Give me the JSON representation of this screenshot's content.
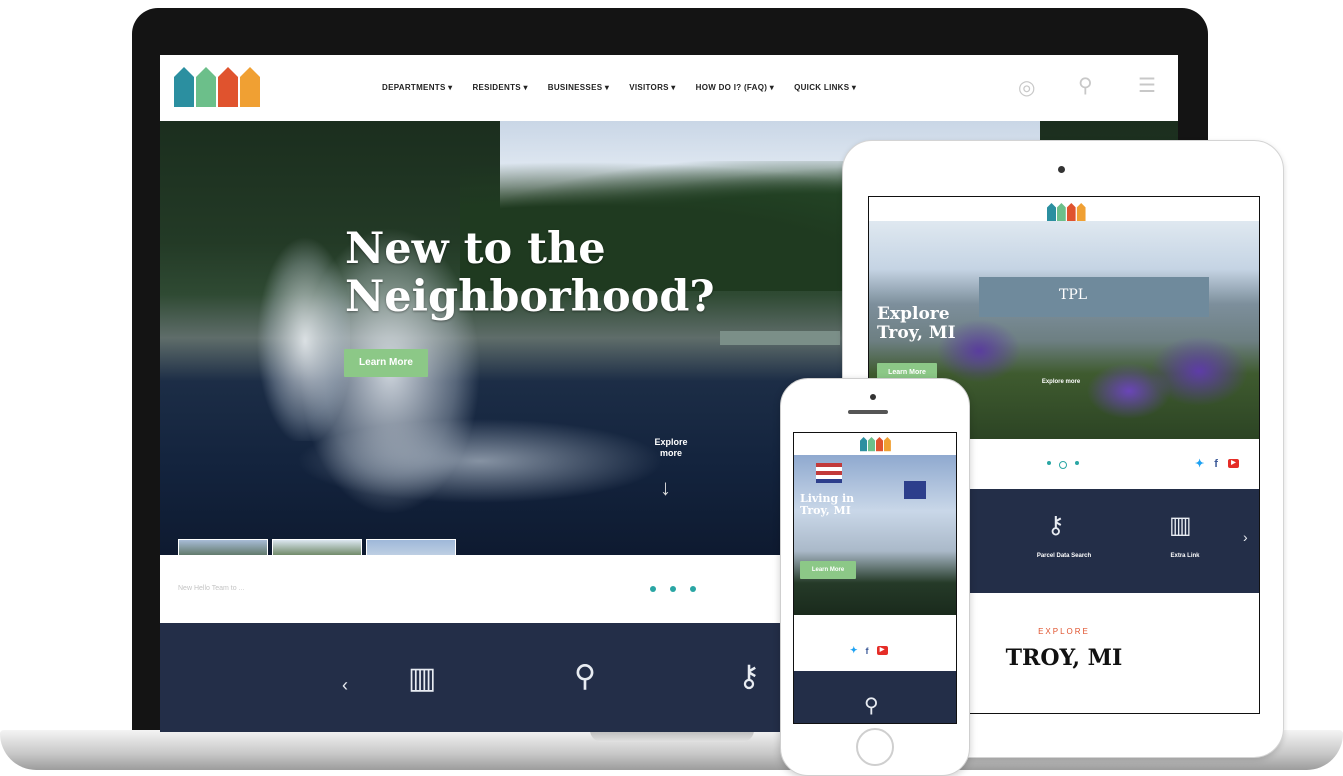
{
  "laptop": {
    "nav": [
      "DEPARTMENTS ▾",
      "RESIDENTS ▾",
      "BUSINESSES ▾",
      "VISITORS ▾",
      "HOW DO I? (FAQ) ▾",
      "QUICK LINKS ▾"
    ],
    "hero_title": "New to the Neighborhood?",
    "hero_button": "Learn More",
    "explore": "Explore more",
    "explore_arrow": "↓",
    "bar_text": "New Hello Team to ..."
  },
  "tablet": {
    "hero_title": "Explore Troy, MI",
    "hero_button": "Learn More",
    "sign_text": "TPL",
    "explore": "Explore more",
    "dark_items": [
      "Parcel Data Search",
      "Extra Link"
    ],
    "kicker": "EXPLORE",
    "heading": "TROY, MI"
  },
  "phone": {
    "hero_title": "Living in Troy, MI",
    "hero_button": "Learn More"
  },
  "social": {
    "twitter": "twitter-icon",
    "facebook": "facebook-icon",
    "youtube": "youtube-icon",
    "f": "f",
    "yt": "▶",
    "tw": "🐦"
  },
  "icons": {
    "search": "⚲",
    "building": "▥",
    "key": "⚷",
    "chevron_left": "‹",
    "chevron_right": "›",
    "menu": "☰",
    "accessibility": "◎"
  },
  "colors": {
    "green_button": "#8cc887",
    "navy": "#232e48",
    "teal": "#2aa6a4",
    "accent": "#e0532e"
  }
}
